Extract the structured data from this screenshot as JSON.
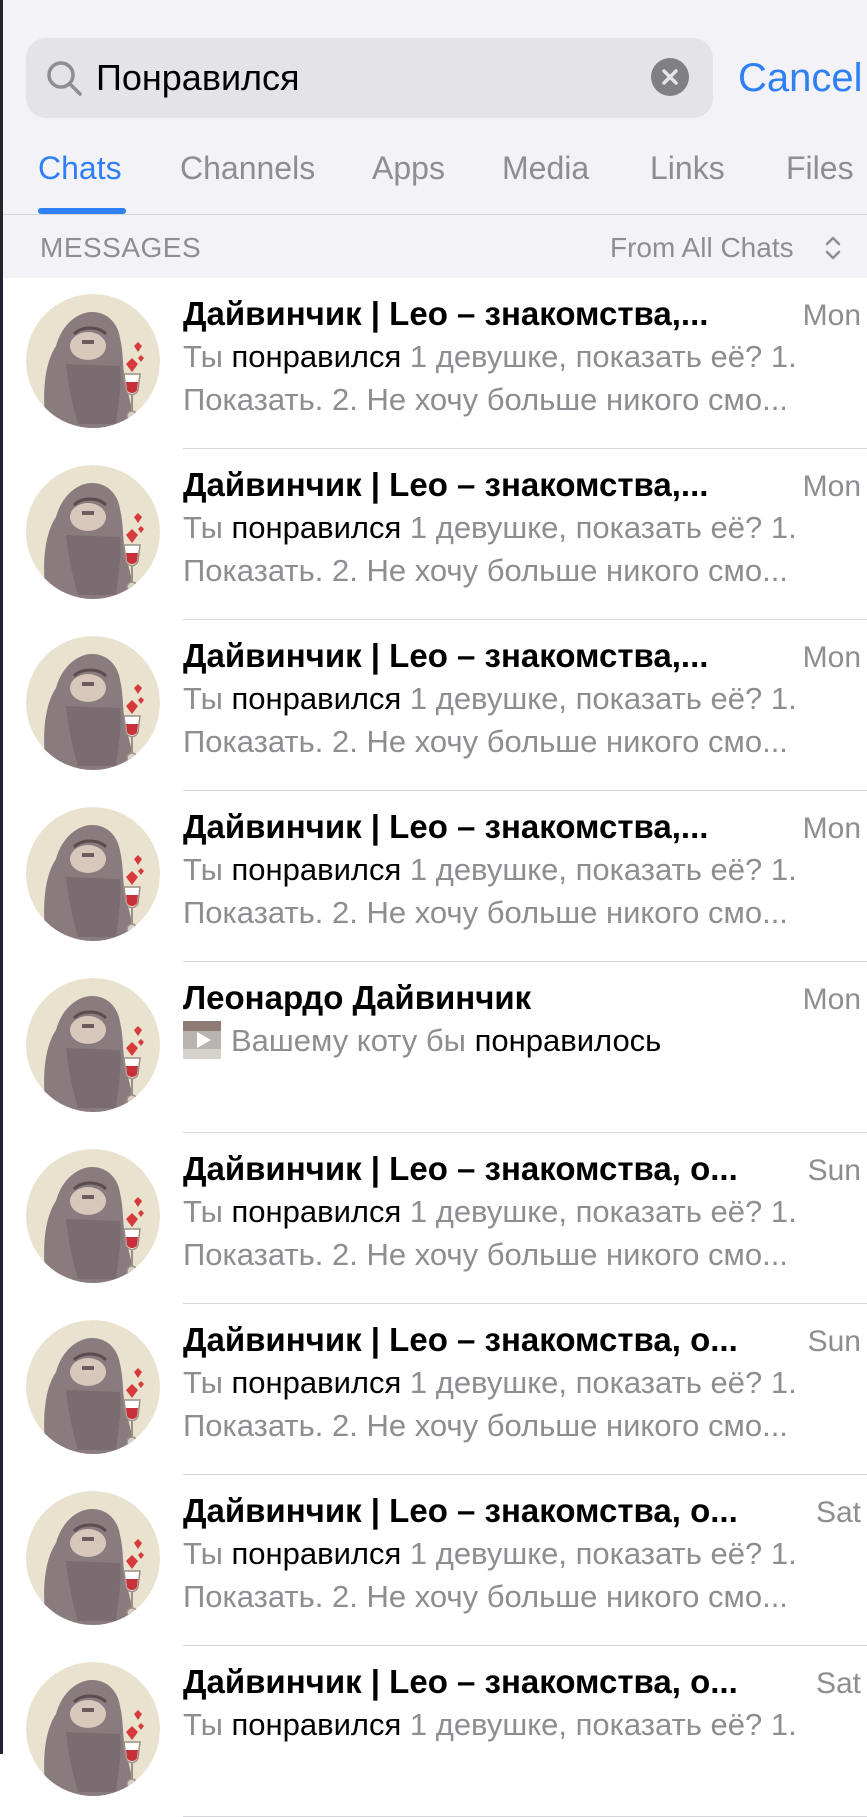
{
  "search": {
    "query": "Понравился",
    "cancel_label": "Cancel"
  },
  "tabs": [
    {
      "label": "Chats",
      "active": true
    },
    {
      "label": "Channels",
      "active": false
    },
    {
      "label": "Apps",
      "active": false
    },
    {
      "label": "Media",
      "active": false
    },
    {
      "label": "Links",
      "active": false
    },
    {
      "label": "Files",
      "active": false
    }
  ],
  "section": {
    "label": "MESSAGES",
    "filter": "From All Chats"
  },
  "colors": {
    "accent": "#2f7ff5",
    "secondary_text": "#8d8d92",
    "highlight_text": "#000000"
  },
  "results": [
    {
      "title": "Дайвинчик | Leo – знакомства,...",
      "time": "Mon",
      "line1_pre": "Ты ",
      "line1_hl": "понравился",
      "line1_post": " 1 девушке, показать её? 1.",
      "line2": "Показать. 2. Не хочу больше никого смо...",
      "icon": "leonardo-avatar"
    },
    {
      "title": "Дайвинчик | Leo – знакомства,...",
      "time": "Mon",
      "line1_pre": "Ты ",
      "line1_hl": "понравился",
      "line1_post": " 1 девушке, показать её? 1.",
      "line2": "Показать. 2. Не хочу больше никого смо...",
      "icon": "leonardo-avatar"
    },
    {
      "title": "Дайвинчик | Leo – знакомства,...",
      "time": "Mon",
      "line1_pre": "Ты ",
      "line1_hl": "понравился",
      "line1_post": " 1 девушке, показать её? 1.",
      "line2": "Показать. 2. Не хочу больше никого смо...",
      "icon": "leonardo-avatar"
    },
    {
      "title": "Дайвинчик | Leo – знакомства,...",
      "time": "Mon",
      "line1_pre": "Ты ",
      "line1_hl": "понравился",
      "line1_post": " 1 девушке, показать её? 1.",
      "line2": "Показать. 2. Не хочу больше никого смо...",
      "icon": "leonardo-avatar"
    },
    {
      "title": "Леонардо Дайвинчик",
      "time": "Mon",
      "line1_pre": "Вашему коту бы ",
      "line1_hl": "понравилось",
      "line1_post": "",
      "line2": "",
      "icon": "leonardo-avatar",
      "media": "video-thumbnail-icon"
    },
    {
      "title": "Дайвинчик | Leo – знакомства, о...",
      "time": "Sun",
      "line1_pre": "Ты ",
      "line1_hl": "понравился",
      "line1_post": " 1 девушке, показать её? 1.",
      "line2": "Показать. 2. Не хочу больше никого смо...",
      "icon": "leonardo-avatar"
    },
    {
      "title": "Дайвинчик | Leo – знакомства, о...",
      "time": "Sun",
      "line1_pre": "Ты ",
      "line1_hl": "понравился",
      "line1_post": " 1 девушке, показать её? 1.",
      "line2": "Показать. 2. Не хочу больше никого смо...",
      "icon": "leonardo-avatar"
    },
    {
      "title": "Дайвинчик | Leo – знакомства, о...",
      "time": "Sat",
      "line1_pre": "Ты ",
      "line1_hl": "понравился",
      "line1_post": " 1 девушке, показать её? 1.",
      "line2": "Показать. 2. Не хочу больше никого смо...",
      "icon": "leonardo-avatar"
    },
    {
      "title": "Дайвинчик | Leo – знакомства, о...",
      "time": "Sat",
      "line1_pre": "Ты ",
      "line1_hl": "понравился",
      "line1_post": " 1 девушке, показать её? 1.",
      "line2": "",
      "icon": "leonardo-avatar"
    }
  ]
}
